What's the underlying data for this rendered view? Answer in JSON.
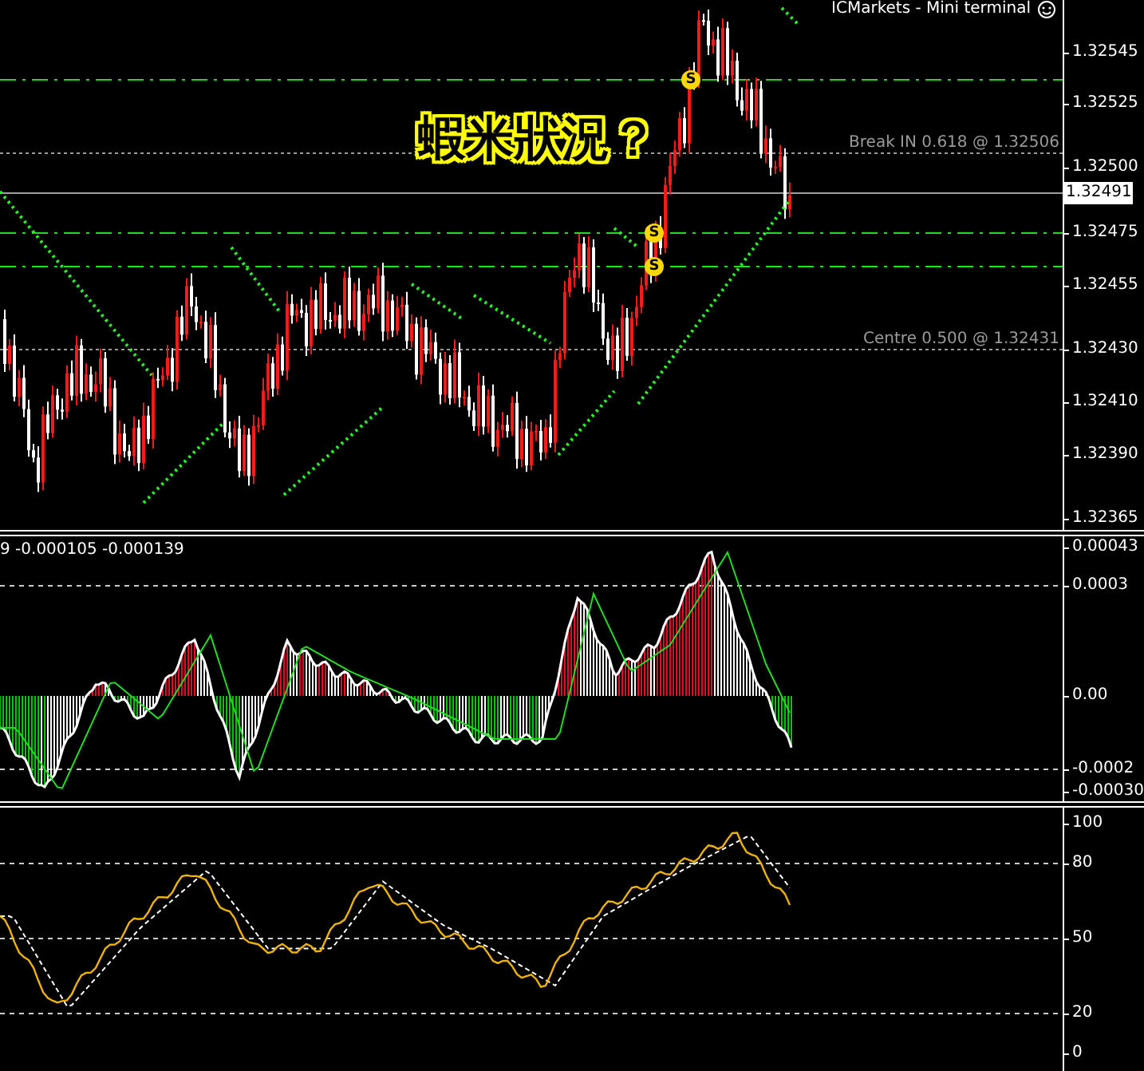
{
  "window": {
    "title": "ICMarkets - Mini terminal"
  },
  "price_panel": {
    "axis_labels": [
      "1.32545",
      "1.32525",
      "1.32500",
      "1.32475",
      "1.32455",
      "1.32430",
      "1.32410",
      "1.32390",
      "1.32365"
    ],
    "current_price": "1.32491",
    "levels": [
      {
        "label": "Break IN 0.618 @ 1.32506"
      },
      {
        "label": "Centre 0.500 @ 1.32431"
      }
    ],
    "signal_markers": [
      "S",
      "S",
      "S"
    ],
    "annotation": "蝦米狀況？"
  },
  "macd_panel": {
    "legend": "9 -0.000105 -0.000139",
    "axis_labels": [
      "0.00043",
      "0.0003",
      "0.00",
      "-0.0002",
      "-0.00030"
    ]
  },
  "stochastic_panel": {
    "axis_labels": [
      "100",
      "80",
      "50",
      "20",
      "0"
    ]
  }
}
